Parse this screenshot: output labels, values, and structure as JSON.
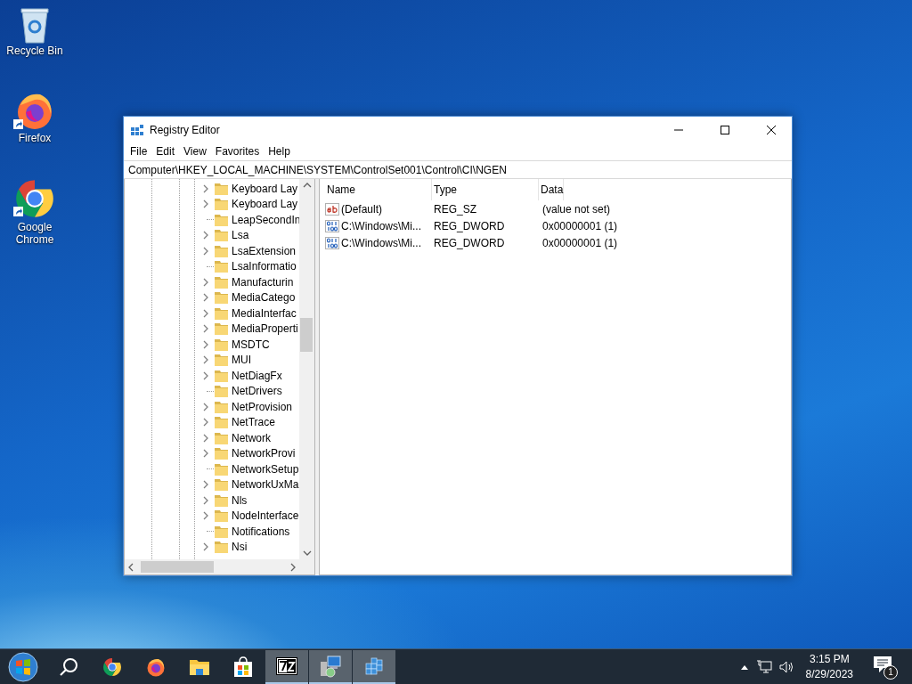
{
  "desktop_icons": [
    {
      "kind": "recycle-bin",
      "label": "Recycle Bin",
      "shortcut": false
    },
    {
      "kind": "firefox",
      "label": "Firefox",
      "shortcut": true
    },
    {
      "kind": "chrome",
      "label": "Google Chrome",
      "shortcut": true
    }
  ],
  "window": {
    "title": "Registry Editor",
    "menu": [
      "File",
      "Edit",
      "View",
      "Favorites",
      "Help"
    ],
    "address": "Computer\\HKEY_LOCAL_MACHINE\\SYSTEM\\ControlSet001\\Control\\CI\\NGEN",
    "tree": [
      {
        "label": "Keyboard Lay",
        "expandable": true
      },
      {
        "label": "Keyboard Lay",
        "expandable": true
      },
      {
        "label": "LeapSecondIn",
        "expandable": false
      },
      {
        "label": "Lsa",
        "expandable": true
      },
      {
        "label": "LsaExtension",
        "expandable": true
      },
      {
        "label": "LsaInformatio",
        "expandable": false
      },
      {
        "label": "Manufacturin",
        "expandable": true
      },
      {
        "label": "MediaCatego",
        "expandable": true
      },
      {
        "label": "MediaInterfac",
        "expandable": true
      },
      {
        "label": "MediaProperti",
        "expandable": true
      },
      {
        "label": "MSDTC",
        "expandable": true
      },
      {
        "label": "MUI",
        "expandable": true
      },
      {
        "label": "NetDiagFx",
        "expandable": true
      },
      {
        "label": "NetDrivers",
        "expandable": false
      },
      {
        "label": "NetProvision",
        "expandable": true
      },
      {
        "label": "NetTrace",
        "expandable": true
      },
      {
        "label": "Network",
        "expandable": true
      },
      {
        "label": "NetworkProvi",
        "expandable": true
      },
      {
        "label": "NetworkSetup",
        "expandable": false
      },
      {
        "label": "NetworkUxMa",
        "expandable": true
      },
      {
        "label": "Nls",
        "expandable": true
      },
      {
        "label": "NodeInterface",
        "expandable": true
      },
      {
        "label": "Notifications",
        "expandable": false
      },
      {
        "label": "Nsi",
        "expandable": true
      }
    ],
    "columns": [
      "Name",
      "Type",
      "Data"
    ],
    "rows": [
      {
        "kind": "string",
        "name": "(Default)",
        "type": "REG_SZ",
        "data": "(value not set)"
      },
      {
        "kind": "binary",
        "name": "C:\\Windows\\Mi...",
        "type": "REG_DWORD",
        "data": "0x00000001 (1)"
      },
      {
        "kind": "binary",
        "name": "C:\\Windows\\Mi...",
        "type": "REG_DWORD",
        "data": "0x00000001 (1)"
      }
    ]
  },
  "taskbar": {
    "items": [
      {
        "kind": "start",
        "running": false
      },
      {
        "kind": "search",
        "running": false
      },
      {
        "kind": "chrome",
        "running": false
      },
      {
        "kind": "firefox",
        "running": false
      },
      {
        "kind": "explorer",
        "running": false
      },
      {
        "kind": "store",
        "running": false
      },
      {
        "kind": "sevenzip",
        "running": true
      },
      {
        "kind": "installer",
        "running": true
      },
      {
        "kind": "regedit",
        "running": true
      }
    ],
    "time": "3:15 PM",
    "date": "8/29/2023",
    "notification_count": "1"
  }
}
